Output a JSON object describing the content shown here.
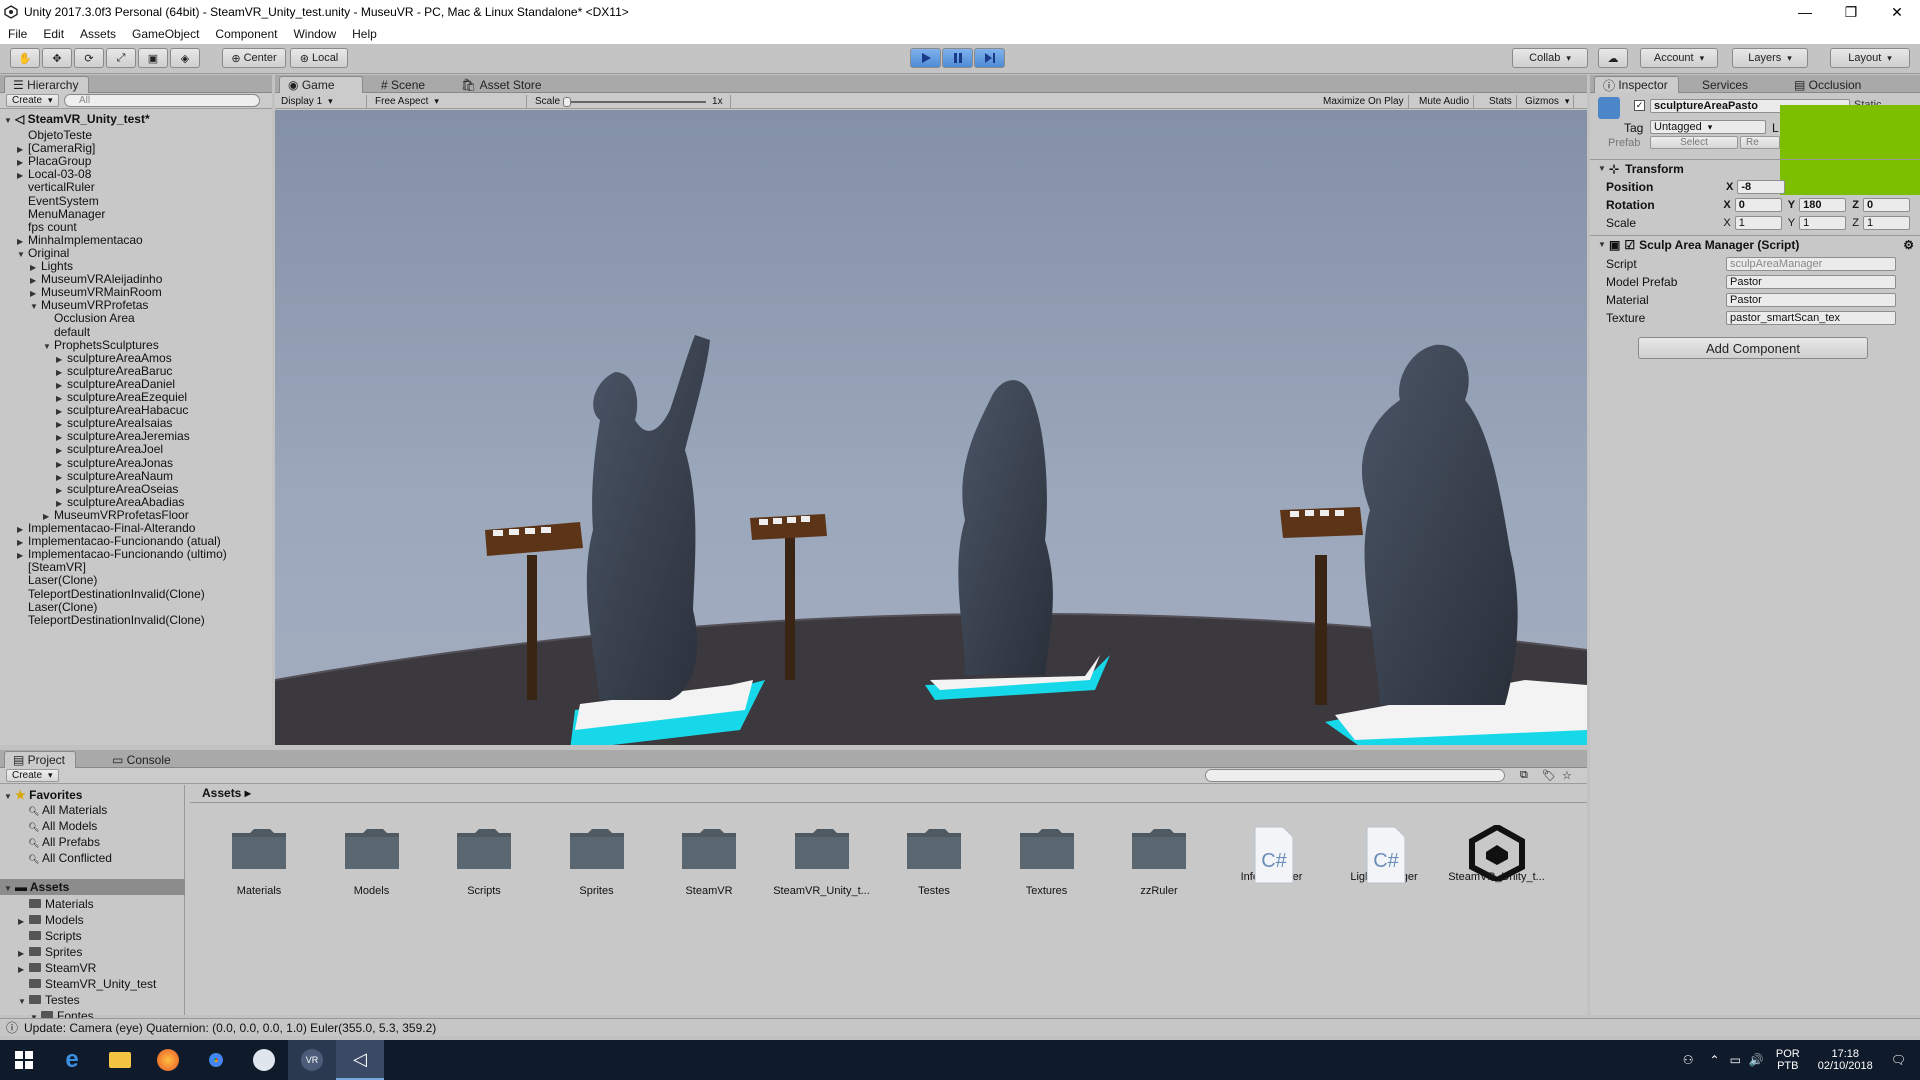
{
  "window": {
    "title": "Unity 2017.3.0f3 Personal (64bit) - SteamVR_Unity_test.unity - MuseuVR - PC, Mac & Linux Standalone* <DX11>",
    "minimize": "—",
    "maximize": "❐",
    "close": "✕"
  },
  "menu": [
    "File",
    "Edit",
    "Assets",
    "GameObject",
    "Component",
    "Window",
    "Help"
  ],
  "toolbar": {
    "center": "Center",
    "local": "Local",
    "collab": "Collab",
    "account": "Account",
    "layers": "Layers",
    "layout": "Layout"
  },
  "hierarchy": {
    "tab": "Hierarchy",
    "create": "Create",
    "search_placeholder": "All",
    "scene": "SteamVR_Unity_test*",
    "items": [
      {
        "label": "ObjetoTeste",
        "indent": 1,
        "arrow": ""
      },
      {
        "label": "[CameraRig]",
        "indent": 1,
        "arrow": "▶"
      },
      {
        "label": "PlacaGroup",
        "indent": 1,
        "arrow": "▶"
      },
      {
        "label": "Local-03-08",
        "indent": 1,
        "arrow": "▶"
      },
      {
        "label": "verticalRuler",
        "indent": 1,
        "arrow": ""
      },
      {
        "label": "EventSystem",
        "indent": 1,
        "arrow": ""
      },
      {
        "label": "MenuManager",
        "indent": 1,
        "arrow": ""
      },
      {
        "label": "fps count",
        "indent": 1,
        "arrow": ""
      },
      {
        "label": "MinhaImplementacao",
        "indent": 1,
        "arrow": "▶"
      },
      {
        "label": "Original",
        "indent": 1,
        "arrow": "▼"
      },
      {
        "label": "Lights",
        "indent": 2,
        "arrow": "▶"
      },
      {
        "label": "MuseumVRAleijadinho",
        "indent": 2,
        "arrow": "▶"
      },
      {
        "label": "MuseumVRMainRoom",
        "indent": 2,
        "arrow": "▶"
      },
      {
        "label": "MuseumVRProfetas",
        "indent": 2,
        "arrow": "▼"
      },
      {
        "label": "Occlusion Area",
        "indent": 3,
        "arrow": ""
      },
      {
        "label": "default",
        "indent": 3,
        "arrow": ""
      },
      {
        "label": "ProphetsSculptures",
        "indent": 3,
        "arrow": "▼"
      },
      {
        "label": "sculptureAreaAmos",
        "indent": 4,
        "arrow": "▶"
      },
      {
        "label": "sculptureAreaBaruc",
        "indent": 4,
        "arrow": "▶"
      },
      {
        "label": "sculptureAreaDaniel",
        "indent": 4,
        "arrow": "▶"
      },
      {
        "label": "sculptureAreaEzequiel",
        "indent": 4,
        "arrow": "▶"
      },
      {
        "label": "sculptureAreaHabacuc",
        "indent": 4,
        "arrow": "▶"
      },
      {
        "label": "sculptureAreaIsaias",
        "indent": 4,
        "arrow": "▶"
      },
      {
        "label": "sculptureAreaJeremias",
        "indent": 4,
        "arrow": "▶"
      },
      {
        "label": "sculptureAreaJoel",
        "indent": 4,
        "arrow": "▶"
      },
      {
        "label": "sculptureAreaJonas",
        "indent": 4,
        "arrow": "▶"
      },
      {
        "label": "sculptureAreaNaum",
        "indent": 4,
        "arrow": "▶"
      },
      {
        "label": "sculptureAreaOseias",
        "indent": 4,
        "arrow": "▶"
      },
      {
        "label": "sculptureAreaAbadias",
        "indent": 4,
        "arrow": "▶"
      },
      {
        "label": "MuseumVRProfetasFloor",
        "indent": 3,
        "arrow": "▶"
      },
      {
        "label": "Implementacao-Final-Alterando",
        "indent": 1,
        "arrow": "▶"
      },
      {
        "label": "Implementacao-Funcionando (atual)",
        "indent": 1,
        "arrow": "▶"
      },
      {
        "label": "Implementacao-Funcionando (ultimo)",
        "indent": 1,
        "arrow": "▶"
      },
      {
        "label": "[SteamVR]",
        "indent": 1,
        "arrow": ""
      },
      {
        "label": "Laser(Clone)",
        "indent": 1,
        "arrow": ""
      },
      {
        "label": "TeleportDestinationInvalid(Clone)",
        "indent": 1,
        "arrow": ""
      },
      {
        "label": "Laser(Clone)",
        "indent": 1,
        "arrow": ""
      },
      {
        "label": "TeleportDestinationInvalid(Clone)",
        "indent": 1,
        "arrow": ""
      }
    ]
  },
  "gameview": {
    "tabs": [
      "Game",
      "Scene",
      "Asset Store"
    ],
    "display": "Display 1",
    "aspect": "Free Aspect",
    "scale_label": "Scale",
    "scale_value": "1x",
    "maximize": "Maximize On Play",
    "mute": "Mute Audio",
    "stats": "Stats",
    "gizmos": "Gizmos"
  },
  "inspector": {
    "tabs": [
      "Inspector",
      "Services",
      "Occlusion"
    ],
    "object_name": "sculptureAreaPasto",
    "static_label": "Static",
    "tag_label": "Tag",
    "tag_value": "Untagged",
    "layer_label": "L",
    "prefab_label": "Prefab",
    "prefab_select": "Select",
    "prefab_revert": "Re",
    "transform_title": "Transform",
    "position_label": "Position",
    "position": {
      "x": "-8",
      "y": "",
      "z": ""
    },
    "rotation_label": "Rotation",
    "rotation": {
      "x": "0",
      "y": "180",
      "z": "0"
    },
    "scale_label": "Scale",
    "scale": {
      "x": "1",
      "y": "1",
      "z": "1"
    },
    "script_title": "Sculp Area Manager (Script)",
    "fields": [
      {
        "label": "Script",
        "value": "sculpAreaManager"
      },
      {
        "label": "Model Prefab",
        "value": "Pastor"
      },
      {
        "label": "Material",
        "value": "Pastor"
      },
      {
        "label": "Texture",
        "value": "pastor_smartScan_tex"
      }
    ],
    "add_component": "Add Component",
    "overlay_color": "#7bbf00"
  },
  "project": {
    "tabs": [
      "Project",
      "Console"
    ],
    "create": "Create",
    "breadcrumb": "Assets",
    "favorites_title": "Favorites",
    "favorites": [
      "All Materials",
      "All Models",
      "All Prefabs",
      "All Conflicted"
    ],
    "assets_title": "Assets",
    "tree": [
      {
        "label": "Materials",
        "arrow": ""
      },
      {
        "label": "Models",
        "arrow": "▶"
      },
      {
        "label": "Scripts",
        "arrow": ""
      },
      {
        "label": "Sprites",
        "arrow": "▶"
      },
      {
        "label": "SteamVR",
        "arrow": "▶"
      },
      {
        "label": "SteamVR_Unity_test",
        "arrow": ""
      },
      {
        "label": "Testes",
        "arrow": "▼"
      },
      {
        "label": "Fontes",
        "arrow": "▼"
      }
    ],
    "grid": [
      {
        "label": "Materials",
        "kind": "folder"
      },
      {
        "label": "Models",
        "kind": "folder"
      },
      {
        "label": "Scripts",
        "kind": "folder"
      },
      {
        "label": "Sprites",
        "kind": "folder"
      },
      {
        "label": "SteamVR",
        "kind": "folder"
      },
      {
        "label": "SteamVR_Unity_t...",
        "kind": "folder"
      },
      {
        "label": "Testes",
        "kind": "folder"
      },
      {
        "label": "Textures",
        "kind": "folder"
      },
      {
        "label": "zzRuler",
        "kind": "folder"
      },
      {
        "label": "InfoManager",
        "kind": "script"
      },
      {
        "label": "LightManager",
        "kind": "script"
      },
      {
        "label": "SteamVR_Unity_t...",
        "kind": "unity"
      }
    ]
  },
  "status": "Update: Camera (eye) Quaternion: (0.0, 0.0, 0.0, 1.0) Euler(355.0, 5.3, 359.2)",
  "taskbar": {
    "lang1": "POR",
    "lang2": "PTB",
    "time": "17:18",
    "date": "02/10/2018"
  }
}
